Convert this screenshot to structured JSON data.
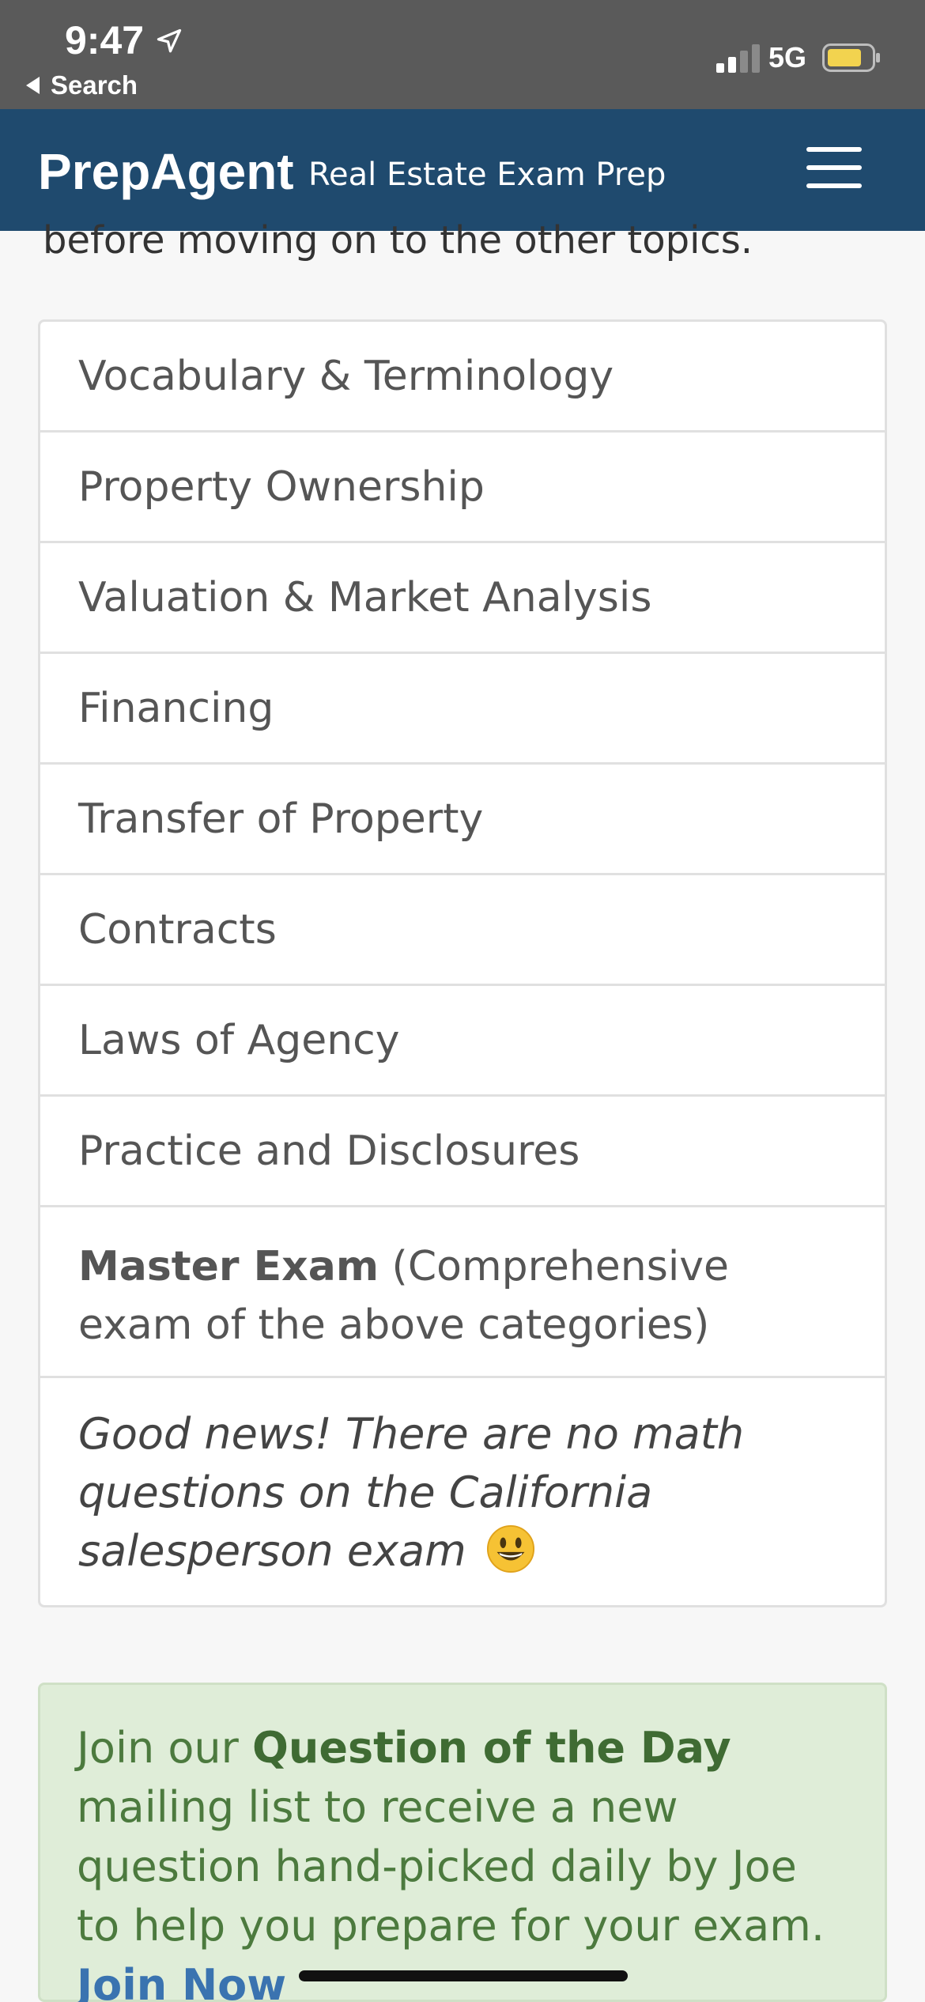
{
  "status_bar": {
    "time": "9:47",
    "back_label": "Search",
    "network": "5G",
    "battery_color": "#f2d34f"
  },
  "header": {
    "brand": "PrepAgent",
    "tagline": "Real Estate Exam Prep",
    "background": "#1f4a6e",
    "menu_icon": "hamburger-menu-icon"
  },
  "intro": {
    "text": "before moving on to the other topics."
  },
  "topics": [
    "Vocabulary & Terminology",
    "Property Ownership",
    "Valuation & Market Analysis",
    "Financing",
    "Transfer of Property",
    "Contracts",
    "Laws of Agency",
    "Practice and Disclosures"
  ],
  "master_exam": {
    "title": "Master Exam",
    "description": "(Comprehensive exam of the above categories)"
  },
  "note": {
    "text": "Good news! There are no math questions on the California salesperson exam",
    "emoji": "grinning-face-emoji"
  },
  "mailing": {
    "prefix": "Join our",
    "highlight": "Question of the Day",
    "body": "mailing list to receive a new question hand-picked daily by Joe to help you prepare for your exam.",
    "link": "Join Now",
    "background": "#dfedd8",
    "link_color": "#3a73b0"
  }
}
